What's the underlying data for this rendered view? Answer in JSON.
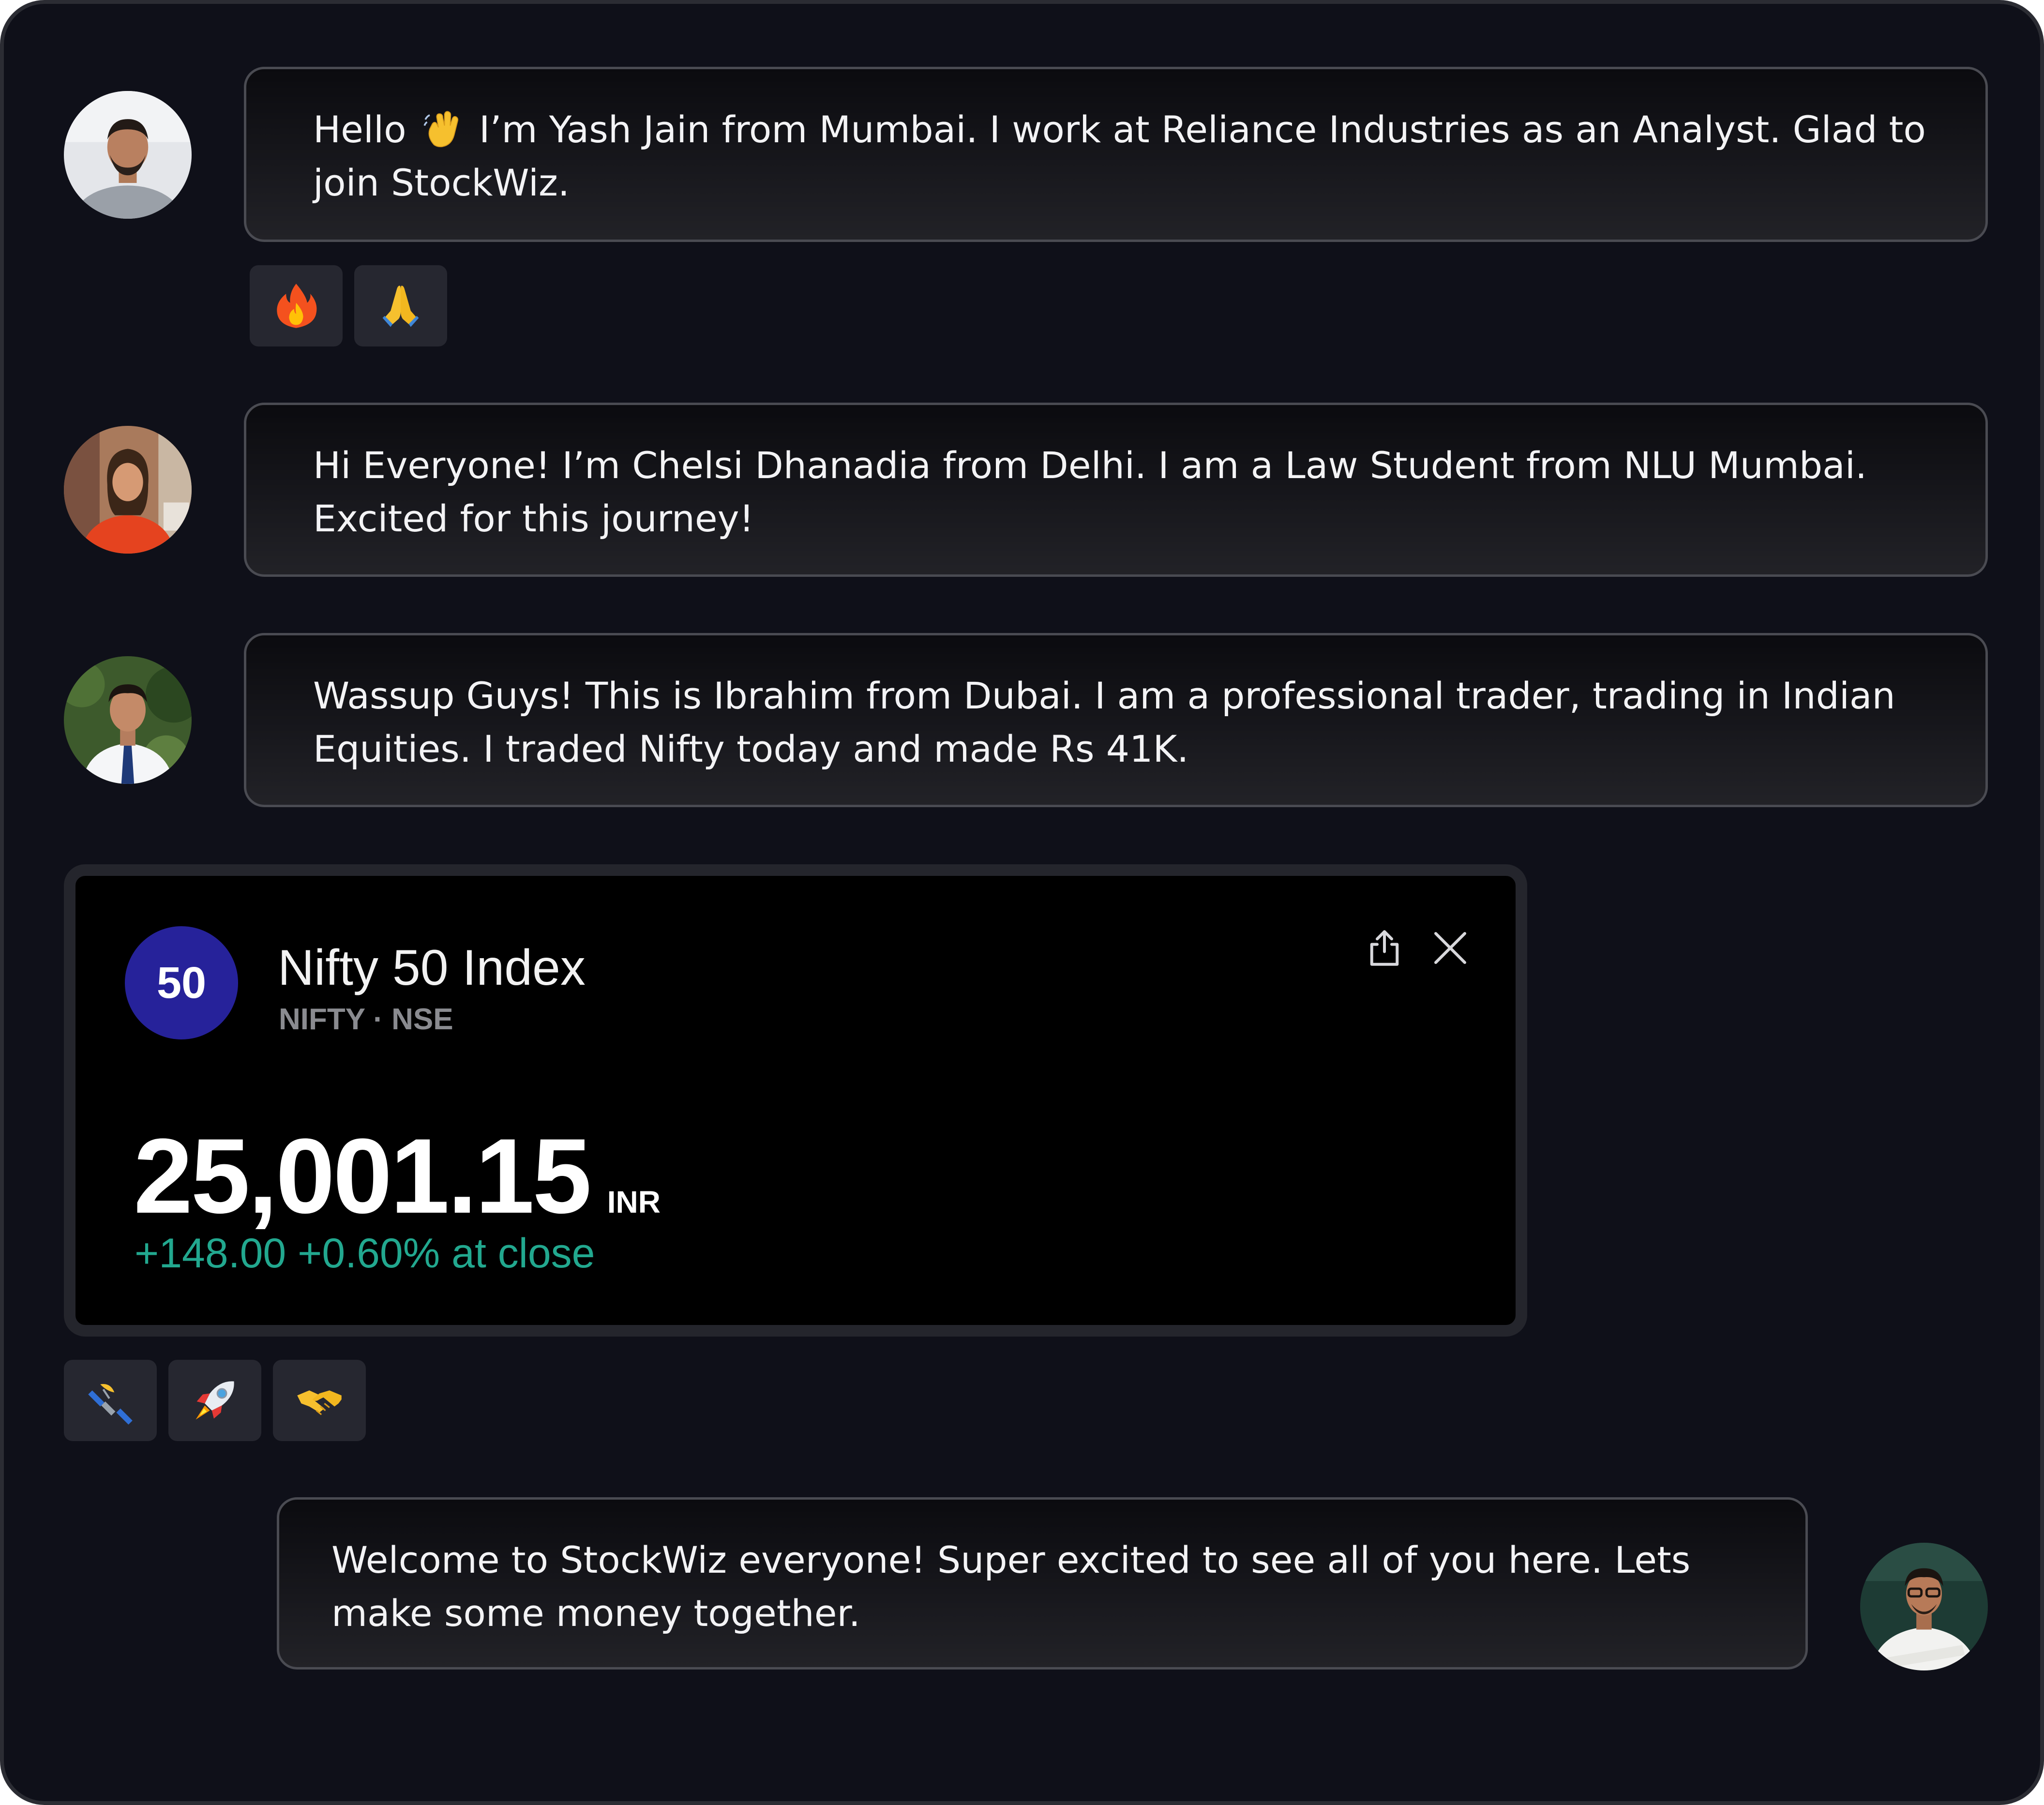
{
  "messages": [
    {
      "sender_avatar": "avatar-yash",
      "text_before_emoji": "Hello ",
      "emoji": "waving-hand-icon",
      "text_after_emoji": " I’m Yash Jain from Mumbai. I work at Reliance Industries as an Analyst. Glad to join StockWiz.",
      "reactions": [
        "fire-icon",
        "folded-hands-icon"
      ]
    },
    {
      "sender_avatar": "avatar-chelsi",
      "text": "Hi Everyone! I’m Chelsi Dhanadia from Delhi. I am a Law Student from NLU Mumbai. Excited for this journey!"
    },
    {
      "sender_avatar": "avatar-ibrahim",
      "text": "Wassup Guys! This is Ibrahim from Dubai. I am a professional trader, trading in Indian Equities. I traded Nifty today and made Rs 41K."
    },
    {
      "sender_avatar": "avatar-host",
      "text": "Welcome to StockWiz everyone! Super excited to see all of you here. Lets make some money together."
    }
  ],
  "stock_card": {
    "logo_text": "50",
    "name": "Nifty 50 Index",
    "subtitle": "NIFTY · NSE",
    "price": "25,001.15",
    "currency": "INR",
    "change": "+148.00 +0.60% at close",
    "reactions": [
      "satellite-icon",
      "rocket-icon",
      "handshake-icon"
    ],
    "icons": [
      "share-icon",
      "close-icon"
    ]
  },
  "colors": {
    "background": "#0f1019",
    "bubble_border": "#4a4b52",
    "reaction_bg": "#262730",
    "logo_bg": "#26229a",
    "change_green": "#22a88f"
  }
}
